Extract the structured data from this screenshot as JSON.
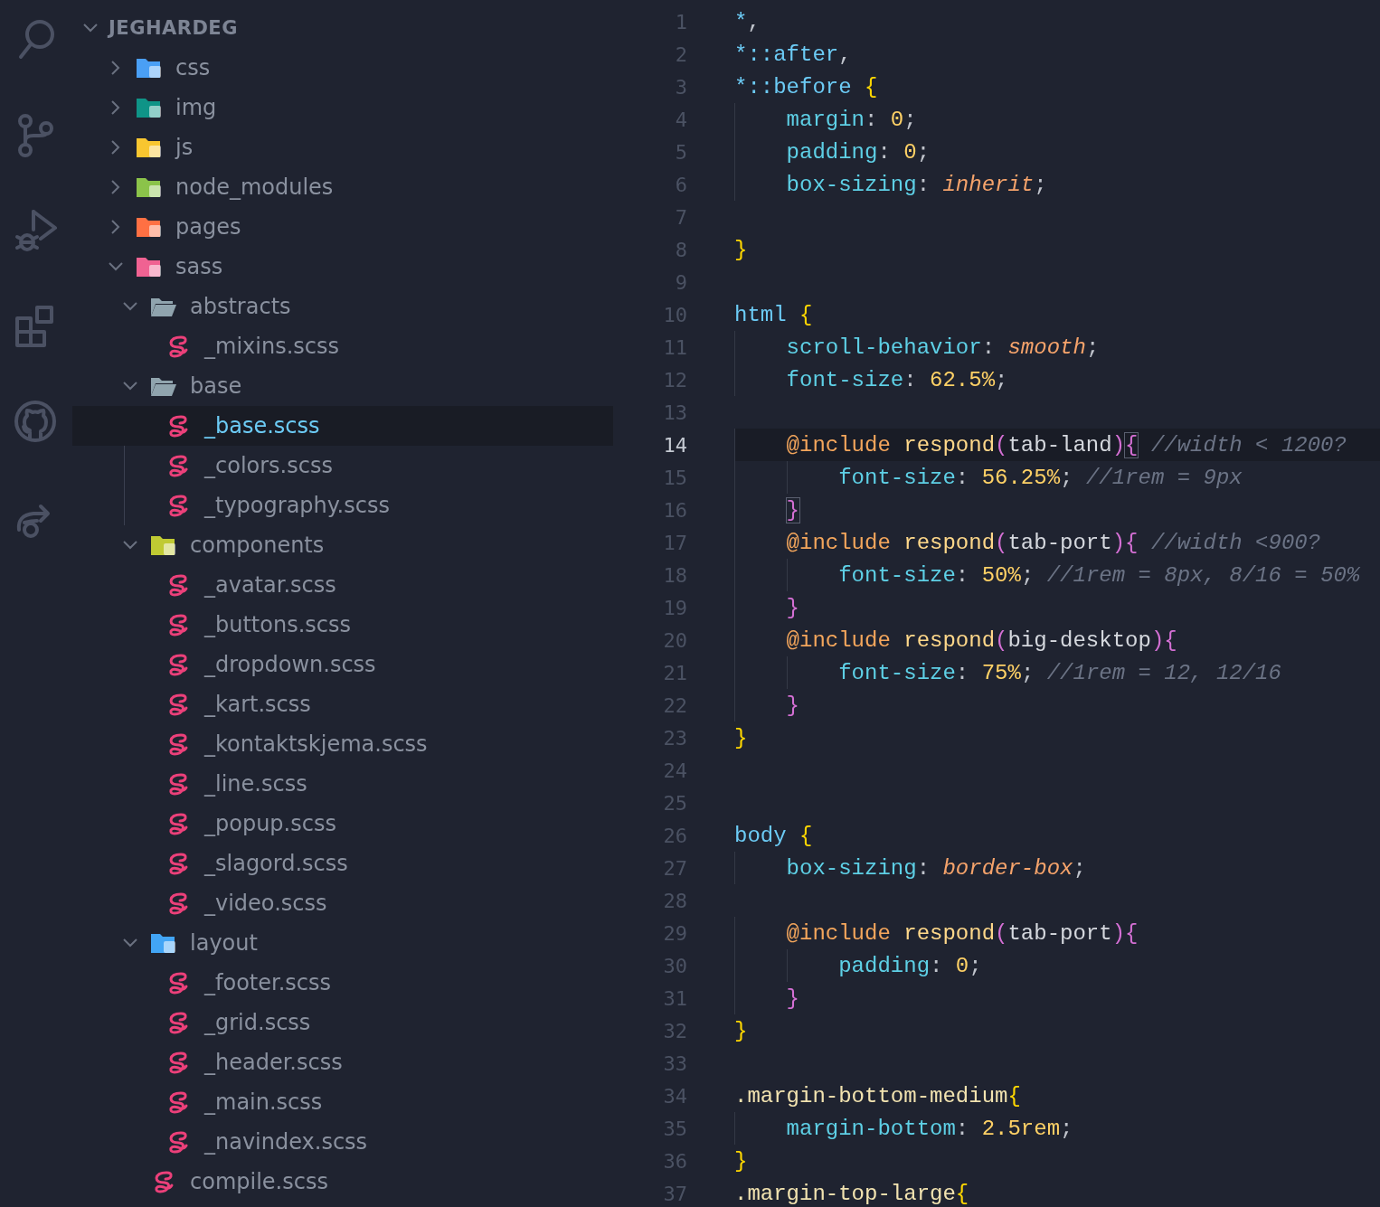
{
  "activity_bar": {
    "items": [
      {
        "kind": "search",
        "selected": false
      },
      {
        "kind": "source-control",
        "selected": false
      },
      {
        "kind": "run-debug",
        "selected": false
      },
      {
        "kind": "extensions",
        "selected": false
      },
      {
        "kind": "github",
        "selected": false
      },
      {
        "kind": "remote",
        "selected": false
      }
    ]
  },
  "explorer": {
    "root": {
      "label": "JEGHARDEG",
      "expanded": true
    },
    "items": [
      {
        "kind": "folder",
        "label": "css",
        "color": "#4a9ff5",
        "expanded": false,
        "selected": false
      },
      {
        "kind": "folder",
        "label": "img",
        "color": "#0f9487",
        "expanded": false,
        "selected": false
      },
      {
        "kind": "folder",
        "label": "js",
        "color": "#f8c630",
        "expanded": false,
        "selected": false
      },
      {
        "kind": "folder",
        "label": "node_modules",
        "color": "#8bc34a",
        "expanded": false,
        "selected": false
      },
      {
        "kind": "folder",
        "label": "pages",
        "color": "#ff7043",
        "expanded": false,
        "selected": false
      },
      {
        "kind": "folder",
        "label": "sass",
        "color": "#f06292",
        "expanded": true,
        "selected": false,
        "children": [
          {
            "kind": "folder",
            "label": "abstracts",
            "color": "#90a4ae",
            "expanded": true,
            "selected": false,
            "children": [
              {
                "kind": "file",
                "label": "_mixins.scss",
                "selected": false
              }
            ]
          },
          {
            "kind": "folder",
            "label": "base",
            "color": "#90a4ae",
            "expanded": true,
            "selected": false,
            "children": [
              {
                "kind": "file",
                "label": "_base.scss",
                "selected": true
              },
              {
                "kind": "file",
                "label": "_colors.scss",
                "selected": false
              },
              {
                "kind": "file",
                "label": "_typography.scss",
                "selected": false
              }
            ]
          },
          {
            "kind": "folder",
            "label": "components",
            "color": "#c0ca33",
            "expanded": true,
            "selected": false,
            "children": [
              {
                "kind": "file",
                "label": "_avatar.scss",
                "selected": false
              },
              {
                "kind": "file",
                "label": "_buttons.scss",
                "selected": false
              },
              {
                "kind": "file",
                "label": "_dropdown.scss",
                "selected": false
              },
              {
                "kind": "file",
                "label": "_kart.scss",
                "selected": false
              },
              {
                "kind": "file",
                "label": "_kontaktskjema.scss",
                "selected": false
              },
              {
                "kind": "file",
                "label": "_line.scss",
                "selected": false
              },
              {
                "kind": "file",
                "label": "_popup.scss",
                "selected": false
              },
              {
                "kind": "file",
                "label": "_slagord.scss",
                "selected": false
              },
              {
                "kind": "file",
                "label": "_video.scss",
                "selected": false
              }
            ]
          },
          {
            "kind": "folder",
            "label": "layout",
            "color": "#42a5f5",
            "expanded": true,
            "selected": false,
            "children": [
              {
                "kind": "file",
                "label": "_footer.scss",
                "selected": false
              },
              {
                "kind": "file",
                "label": "_grid.scss",
                "selected": false
              },
              {
                "kind": "file",
                "label": "_header.scss",
                "selected": false
              },
              {
                "kind": "file",
                "label": "_main.scss",
                "selected": false
              },
              {
                "kind": "file",
                "label": "_navindex.scss",
                "selected": false
              }
            ]
          },
          {
            "kind": "file",
            "label": "compile.scss",
            "selected": false
          }
        ]
      }
    ]
  },
  "editor": {
    "lines": [
      {
        "number": "1",
        "current": false,
        "tokens": [
          {
            "text": "*",
            "kind": "sel"
          },
          {
            "text": ",",
            "kind": "p"
          }
        ]
      },
      {
        "number": "2",
        "current": false,
        "tokens": [
          {
            "text": "*::after",
            "kind": "sel"
          },
          {
            "text": ",",
            "kind": "p"
          }
        ]
      },
      {
        "number": "3",
        "current": false,
        "tokens": [
          {
            "text": "*::before",
            "kind": "sel"
          },
          {
            "text": " {",
            "kind": "brace"
          }
        ]
      },
      {
        "number": "4",
        "current": false,
        "tokens": [
          {
            "text": "    margin",
            "kind": "prop"
          },
          {
            "text": ": ",
            "kind": "p"
          },
          {
            "text": "0",
            "kind": "num"
          },
          {
            "text": ";",
            "kind": "p"
          }
        ]
      },
      {
        "number": "5",
        "current": false,
        "tokens": [
          {
            "text": "    padding",
            "kind": "prop"
          },
          {
            "text": ": ",
            "kind": "p"
          },
          {
            "text": "0",
            "kind": "num"
          },
          {
            "text": ";",
            "kind": "p"
          }
        ]
      },
      {
        "number": "6",
        "current": false,
        "tokens": [
          {
            "text": "    box-sizing",
            "kind": "prop"
          },
          {
            "text": ": ",
            "kind": "p"
          },
          {
            "text": "inherit",
            "kind": "val"
          },
          {
            "text": ";",
            "kind": "p"
          }
        ]
      },
      {
        "number": "7",
        "current": false
      },
      {
        "number": "8",
        "current": false,
        "tokens": [
          {
            "text": "}",
            "kind": "brace"
          }
        ]
      },
      {
        "number": "9",
        "current": false
      },
      {
        "number": "10",
        "current": false,
        "tokens": [
          {
            "text": "html",
            "kind": "sel"
          },
          {
            "text": " {",
            "kind": "brace"
          }
        ]
      },
      {
        "number": "11",
        "current": false,
        "tokens": [
          {
            "text": "    scroll-behavior",
            "kind": "prop"
          },
          {
            "text": ": ",
            "kind": "p"
          },
          {
            "text": "smooth",
            "kind": "val"
          },
          {
            "text": ";",
            "kind": "p"
          }
        ]
      },
      {
        "number": "12",
        "current": false,
        "tokens": [
          {
            "text": "    font-size",
            "kind": "prop"
          },
          {
            "text": ": ",
            "kind": "p"
          },
          {
            "text": "62.5%",
            "kind": "num"
          },
          {
            "text": ";",
            "kind": "p"
          }
        ]
      },
      {
        "number": "13",
        "current": false
      },
      {
        "number": "14",
        "current": true,
        "tokens": [
          {
            "text": "    @include",
            "kind": "kw"
          },
          {
            "text": " respond",
            "kind": "fn"
          },
          {
            "text": "(",
            "kind": "paren"
          },
          {
            "text": "tab-land",
            "kind": "arg"
          },
          {
            "text": ")",
            "kind": "paren"
          },
          {
            "text": "{",
            "kind": "match"
          },
          {
            "text": " //width < 1200?",
            "kind": "comment"
          }
        ]
      },
      {
        "number": "15",
        "current": false,
        "tokens": [
          {
            "text": "        font-size",
            "kind": "prop"
          },
          {
            "text": ": ",
            "kind": "p"
          },
          {
            "text": "56.25%",
            "kind": "num"
          },
          {
            "text": ";",
            "kind": "p"
          },
          {
            "text": " //1rem = 9px",
            "kind": "comment"
          }
        ]
      },
      {
        "number": "16",
        "current": false,
        "tokens": [
          {
            "text": "    }",
            "kind": "match"
          }
        ]
      },
      {
        "number": "17",
        "current": false,
        "tokens": [
          {
            "text": "    @include",
            "kind": "kw"
          },
          {
            "text": " respond",
            "kind": "fn"
          },
          {
            "text": "(",
            "kind": "paren"
          },
          {
            "text": "tab-port",
            "kind": "arg"
          },
          {
            "text": ")",
            "kind": "paren"
          },
          {
            "text": "{",
            "kind": "brace2"
          },
          {
            "text": " //width <900?",
            "kind": "comment"
          }
        ]
      },
      {
        "number": "18",
        "current": false,
        "tokens": [
          {
            "text": "        font-size",
            "kind": "prop"
          },
          {
            "text": ": ",
            "kind": "p"
          },
          {
            "text": "50%",
            "kind": "num"
          },
          {
            "text": ";",
            "kind": "p"
          },
          {
            "text": " //1rem = 8px, 8/16 = 50%",
            "kind": "comment"
          }
        ]
      },
      {
        "number": "19",
        "current": false,
        "tokens": [
          {
            "text": "    }",
            "kind": "brace2"
          }
        ]
      },
      {
        "number": "20",
        "current": false,
        "tokens": [
          {
            "text": "    @include",
            "kind": "kw"
          },
          {
            "text": " respond",
            "kind": "fn"
          },
          {
            "text": "(",
            "kind": "paren"
          },
          {
            "text": "big-desktop",
            "kind": "arg"
          },
          {
            "text": ")",
            "kind": "paren"
          },
          {
            "text": "{",
            "kind": "brace2"
          }
        ]
      },
      {
        "number": "21",
        "current": false,
        "tokens": [
          {
            "text": "        font-size",
            "kind": "prop"
          },
          {
            "text": ": ",
            "kind": "p"
          },
          {
            "text": "75%",
            "kind": "num"
          },
          {
            "text": ";",
            "kind": "p"
          },
          {
            "text": " //1rem = 12, 12/16",
            "kind": "comment"
          }
        ]
      },
      {
        "number": "22",
        "current": false,
        "tokens": [
          {
            "text": "    }",
            "kind": "brace2"
          }
        ]
      },
      {
        "number": "23",
        "current": false,
        "tokens": [
          {
            "text": "}",
            "kind": "brace"
          }
        ]
      },
      {
        "number": "24",
        "current": false
      },
      {
        "number": "25",
        "current": false
      },
      {
        "number": "26",
        "current": false,
        "tokens": [
          {
            "text": "body",
            "kind": "sel"
          },
          {
            "text": " {",
            "kind": "brace"
          }
        ]
      },
      {
        "number": "27",
        "current": false,
        "tokens": [
          {
            "text": "    box-sizing",
            "kind": "prop"
          },
          {
            "text": ": ",
            "kind": "p"
          },
          {
            "text": "border-box",
            "kind": "val"
          },
          {
            "text": ";",
            "kind": "p"
          }
        ]
      },
      {
        "number": "28",
        "current": false
      },
      {
        "number": "29",
        "current": false,
        "tokens": [
          {
            "text": "    @include",
            "kind": "kw"
          },
          {
            "text": " respond",
            "kind": "fn"
          },
          {
            "text": "(",
            "kind": "paren"
          },
          {
            "text": "tab-port",
            "kind": "arg"
          },
          {
            "text": ")",
            "kind": "paren"
          },
          {
            "text": "{",
            "kind": "brace2"
          }
        ]
      },
      {
        "number": "30",
        "current": false,
        "tokens": [
          {
            "text": "        padding",
            "kind": "prop"
          },
          {
            "text": ": ",
            "kind": "p"
          },
          {
            "text": "0",
            "kind": "num"
          },
          {
            "text": ";",
            "kind": "p"
          }
        ]
      },
      {
        "number": "31",
        "current": false,
        "tokens": [
          {
            "text": "    }",
            "kind": "brace2"
          }
        ]
      },
      {
        "number": "32",
        "current": false,
        "tokens": [
          {
            "text": "}",
            "kind": "brace"
          }
        ]
      },
      {
        "number": "33",
        "current": false
      },
      {
        "number": "34",
        "current": false,
        "tokens": [
          {
            "text": ".margin-bottom-medium",
            "kind": "cls"
          },
          {
            "text": "{",
            "kind": "brace"
          }
        ]
      },
      {
        "number": "35",
        "current": false,
        "tokens": [
          {
            "text": "    margin-bottom",
            "kind": "prop"
          },
          {
            "text": ": ",
            "kind": "p"
          },
          {
            "text": "2.5rem",
            "kind": "num"
          },
          {
            "text": ";",
            "kind": "p"
          }
        ]
      },
      {
        "number": "36",
        "current": false,
        "tokens": [
          {
            "text": "}",
            "kind": "brace"
          }
        ]
      },
      {
        "number": "37",
        "current": false,
        "tokens": [
          {
            "text": ".margin-top-large",
            "kind": "cls"
          },
          {
            "text": "{",
            "kind": "brace"
          }
        ]
      }
    ]
  }
}
